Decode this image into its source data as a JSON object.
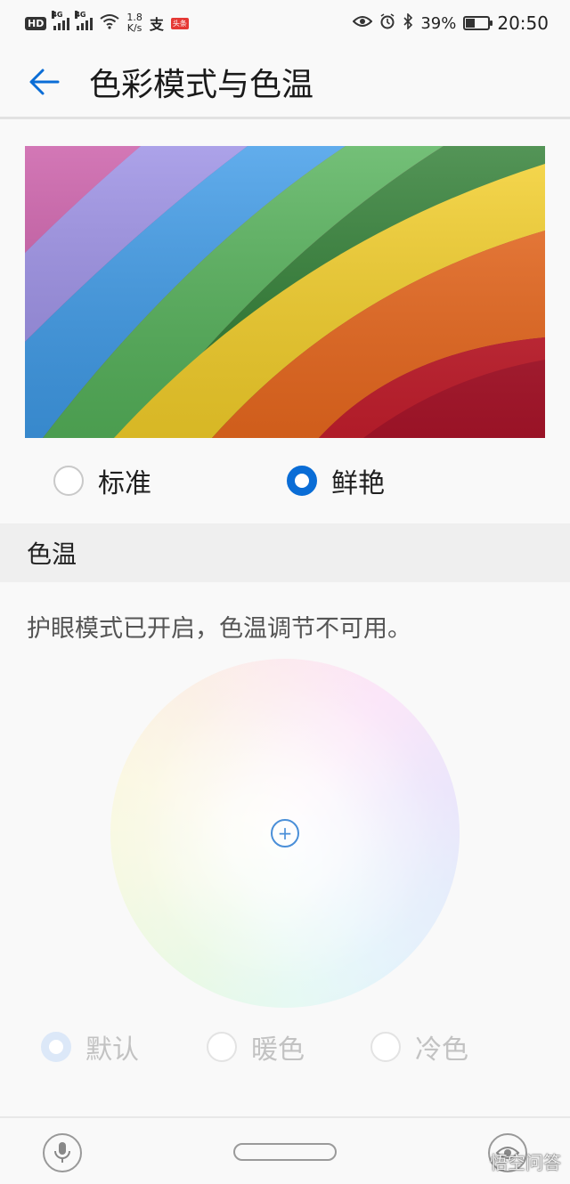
{
  "status_bar": {
    "hd": "HD",
    "net1": "4G",
    "net2": "4G",
    "speed_value": "1.8",
    "speed_unit": "K/s",
    "app_tag": "头条",
    "battery_percent": "39%",
    "battery_level": 0.39,
    "time": "20:50",
    "icons": [
      "signal-icon",
      "signal-icon",
      "wifi-icon",
      "alipay-icon",
      "eye-icon",
      "alarm-icon",
      "bluetooth-icon",
      "battery-icon"
    ]
  },
  "header": {
    "title": "色彩模式与色温",
    "back_icon": "arrow-left-icon"
  },
  "color_mode": {
    "options": [
      {
        "label": "标准",
        "selected": false
      },
      {
        "label": "鲜艳",
        "selected": true
      }
    ]
  },
  "color_temp": {
    "section_title": "色温",
    "notice": "护眼模式已开启，色温调节不可用。",
    "options": [
      {
        "label": "默认",
        "selected": true
      },
      {
        "label": "暖色",
        "selected": false
      },
      {
        "label": "冷色",
        "selected": false
      }
    ],
    "enabled": false
  },
  "nav": {
    "icons": [
      "microphone-icon",
      "home-pill-icon",
      "eye-icon"
    ]
  },
  "watermark": "悟空问答",
  "colors": {
    "accent": "#0a6dd6",
    "disabled_text": "#c2c2c2",
    "section_bg": "#efefef"
  }
}
